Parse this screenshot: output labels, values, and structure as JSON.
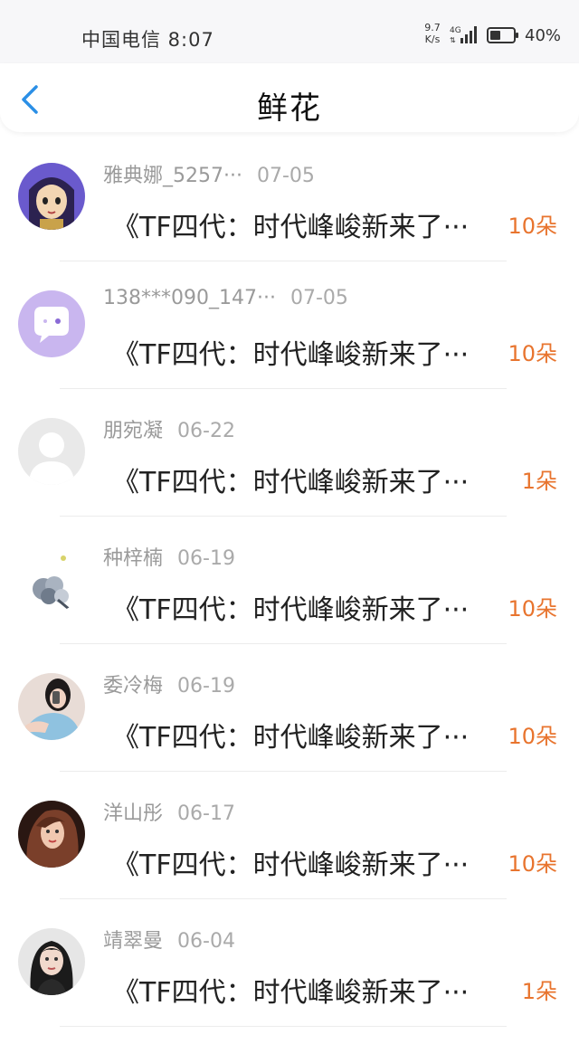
{
  "status_bar": {
    "carrier": "中国电信 8:07",
    "speed_value": "9.7",
    "speed_unit": "K/s",
    "network": "4G",
    "battery": "40%"
  },
  "header": {
    "title": "鲜花"
  },
  "items": [
    {
      "name": "雅典娜_5257···",
      "date": "07-05",
      "text": "《TF四代：时代峰峻新来了···",
      "count": "10朵",
      "avatar": "cartoon-girl"
    },
    {
      "name": "138***090_147···",
      "date": "07-05",
      "text": "《TF四代：时代峰峻新来了···",
      "count": "10朵",
      "avatar": "chat-bubble"
    },
    {
      "name": "朋宛凝",
      "date": "06-22",
      "text": "《TF四代：时代峰峻新来了···",
      "count": "1朵",
      "avatar": "default-user"
    },
    {
      "name": "种梓楠",
      "date": "06-19",
      "text": "《TF四代：时代峰峻新来了···",
      "count": "10朵",
      "avatar": "flower-bouquet"
    },
    {
      "name": "委冷梅",
      "date": "06-19",
      "text": "《TF四代：时代峰峻新来了···",
      "count": "10朵",
      "avatar": "photo-girl-selfie"
    },
    {
      "name": "洋山彤",
      "date": "06-17",
      "text": "《TF四代：时代峰峻新来了···",
      "count": "10朵",
      "avatar": "photo-girl-longhair"
    },
    {
      "name": "靖翠曼",
      "date": "06-04",
      "text": "《TF四代：时代峰峻新来了···",
      "count": "1朵",
      "avatar": "photo-woman"
    }
  ],
  "colors": {
    "accent_blue": "#2b8fe6",
    "count_orange": "#e8742e"
  }
}
